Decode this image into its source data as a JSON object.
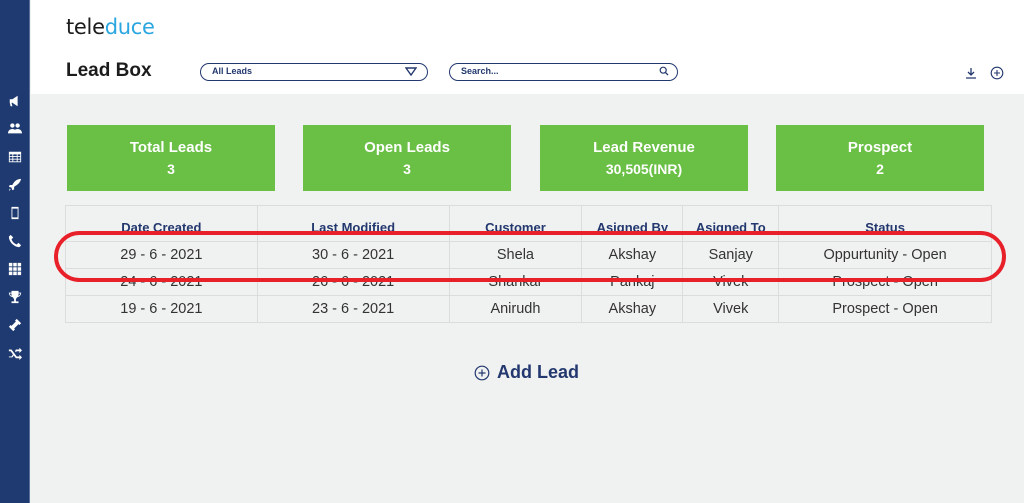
{
  "app": {
    "logo_part1": "tele",
    "logo_part2": "duce",
    "brand_colors": {
      "logo_dark": "#1c1c1c",
      "logo_accent": "#2aa6e0",
      "sidebar": "#1e3a70",
      "card_green": "#6abf45",
      "text_navy": "#23386e",
      "highlight": "#e8202a"
    }
  },
  "sidebar": {
    "items": [
      {
        "icon": "megaphone-icon"
      },
      {
        "icon": "users-icon"
      },
      {
        "icon": "table-icon"
      },
      {
        "icon": "rocket-icon"
      },
      {
        "icon": "mobile-icon"
      },
      {
        "icon": "phone-icon"
      },
      {
        "icon": "grid-icon"
      },
      {
        "icon": "trophy-icon"
      },
      {
        "icon": "ticket-icon"
      },
      {
        "icon": "shuffle-icon"
      }
    ]
  },
  "header": {
    "title": "Lead Box",
    "filter_select": {
      "value": "All Leads"
    },
    "search": {
      "placeholder": "Search...",
      "value": ""
    },
    "actions": [
      {
        "icon": "download-icon"
      },
      {
        "icon": "add-circle-icon"
      }
    ]
  },
  "summary_cards": [
    {
      "label": "Total Leads",
      "value": "3"
    },
    {
      "label": "Open Leads",
      "value": "3"
    },
    {
      "label": "Lead Revenue",
      "value": "30,505(INR)"
    },
    {
      "label": "Prospect",
      "value": "2"
    }
  ],
  "leads_table": {
    "columns": [
      "Date Created",
      "Last Modified",
      "Customer",
      "Asigned By",
      "Asigned To",
      "Status"
    ],
    "rows": [
      [
        "29 - 6 - 2021",
        "30 - 6 - 2021",
        "Shela",
        "Akshay",
        "Sanjay",
        "Oppurtunity - Open"
      ],
      [
        "24 - 6 - 2021",
        "26 - 6 - 2021",
        "Shankar",
        "Pankaj",
        "Vivek",
        "Prospect - Open"
      ],
      [
        "19 - 6 - 2021",
        "23 - 6 - 2021",
        "Anirudh",
        "Akshay",
        "Vivek",
        "Prospect - Open"
      ]
    ],
    "highlighted_row": 0
  },
  "add_lead_label": "Add Lead"
}
